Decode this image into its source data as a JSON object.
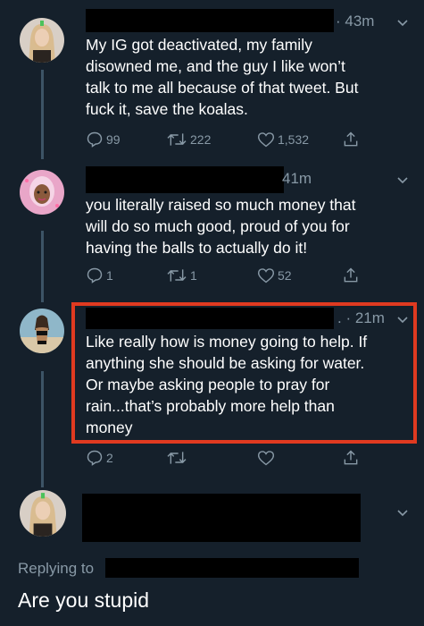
{
  "tweets": [
    {
      "time": "· 43m",
      "text_lines": [
        "My IG got deactivated, my family",
        "disowned me, and the guy I like won’t",
        "talk to me all because of that tweet. But",
        "fuck it, save the koalas."
      ],
      "replies": "99",
      "retweets": "222",
      "likes": "1,532"
    },
    {
      "time": "41m",
      "text_lines": [
        "you literally raised so much money that",
        "will do so much good, proud of you for",
        "having the balls to actually do it!"
      ],
      "replies": "1",
      "retweets": "1",
      "likes": "52"
    },
    {
      "time": ". · 21m",
      "text_lines": [
        "Like really how is money going to help. If",
        "anything she should be asking for water.",
        "Or maybe asking people to pray for",
        "rain...that’s probably more help than",
        "money"
      ],
      "replies": "2",
      "retweets": "",
      "likes": ""
    }
  ],
  "reply": {
    "label": "Replying to",
    "text": "Are you stupid"
  },
  "colors": {
    "background": "#15202b",
    "secondary_text": "#8899a6",
    "highlight_border": "#e03a20",
    "redaction": "#000000"
  },
  "icons": [
    "reply-icon",
    "retweet-icon",
    "like-icon",
    "share-icon",
    "chevron-down-icon"
  ]
}
